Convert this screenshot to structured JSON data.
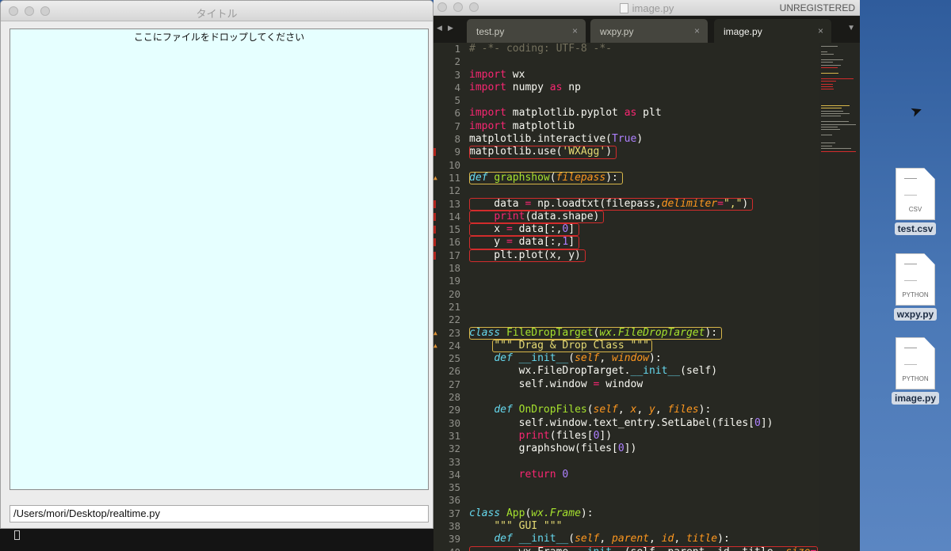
{
  "wx_window": {
    "title": "タイトル",
    "drop_label": "ここにファイルをドロップしてください",
    "path_value": "/Users/mori/Desktop/realtime.py"
  },
  "editor": {
    "title": "image.py",
    "registration": "UNREGISTERED",
    "tabs": [
      {
        "label": "test.py",
        "active": false
      },
      {
        "label": "wxpy.py",
        "active": false
      },
      {
        "label": "image.py",
        "active": true
      }
    ],
    "lines": [
      {
        "n": "1",
        "segs": [
          [
            "c",
            "# -*- coding: UTF-8 -*-"
          ]
        ]
      },
      {
        "n": "2",
        "segs": []
      },
      {
        "n": "3",
        "segs": [
          [
            "k",
            "import"
          ],
          [
            "",
            " wx"
          ]
        ]
      },
      {
        "n": "4",
        "segs": [
          [
            "k",
            "import"
          ],
          [
            "",
            " numpy "
          ],
          [
            "k",
            "as"
          ],
          [
            "",
            " np"
          ]
        ]
      },
      {
        "n": "5",
        "segs": []
      },
      {
        "n": "6",
        "segs": [
          [
            "k",
            "import"
          ],
          [
            "",
            " matplotlib.pyplot "
          ],
          [
            "k",
            "as"
          ],
          [
            "",
            " plt"
          ]
        ]
      },
      {
        "n": "7",
        "segs": [
          [
            "k",
            "import"
          ],
          [
            "",
            " matplotlib"
          ]
        ]
      },
      {
        "n": "8",
        "segs": [
          [
            "",
            "matplotlib.interactive("
          ],
          [
            "n",
            "True"
          ],
          [
            "",
            ")"
          ]
        ]
      },
      {
        "n": "9",
        "segs": [
          [
            "",
            "matplotlib.use("
          ],
          [
            "s",
            "'WXAgg'"
          ],
          [
            "",
            ")"
          ]
        ],
        "mark": "err",
        "box": "r"
      },
      {
        "n": "10",
        "segs": []
      },
      {
        "n": "11",
        "segs": [
          [
            "bi",
            "def"
          ],
          [
            "",
            " "
          ],
          [
            "f",
            "graphshow"
          ],
          [
            "",
            "("
          ],
          [
            "p",
            "filepass"
          ],
          [
            "",
            "):"
          ]
        ],
        "mark": "warn",
        "box": "y"
      },
      {
        "n": "12",
        "segs": []
      },
      {
        "n": "13",
        "segs": [
          [
            "",
            "    data "
          ],
          [
            "k",
            "="
          ],
          [
            "",
            " np.loadtxt(filepass,"
          ],
          [
            "p",
            "delimiter"
          ],
          [
            "k",
            "="
          ],
          [
            "s",
            "\",\""
          ],
          [
            "",
            ")"
          ]
        ],
        "mark": "err",
        "box": "r"
      },
      {
        "n": "14",
        "segs": [
          [
            "",
            "    "
          ],
          [
            "k",
            "print"
          ],
          [
            "",
            "(data.shape)"
          ]
        ],
        "mark": "err",
        "box": "r"
      },
      {
        "n": "15",
        "segs": [
          [
            "",
            "    x "
          ],
          [
            "k",
            "="
          ],
          [
            "",
            " data[:,"
          ],
          [
            "n",
            "0"
          ],
          [
            "",
            "]"
          ]
        ],
        "mark": "err",
        "box": "r"
      },
      {
        "n": "16",
        "segs": [
          [
            "",
            "    y "
          ],
          [
            "k",
            "="
          ],
          [
            "",
            " data[:,"
          ],
          [
            "n",
            "1"
          ],
          [
            "",
            "]"
          ]
        ],
        "mark": "err",
        "box": "r"
      },
      {
        "n": "17",
        "segs": [
          [
            "",
            "    plt.plot(x, y)"
          ]
        ],
        "mark": "err",
        "box": "r"
      },
      {
        "n": "18",
        "segs": []
      },
      {
        "n": "19",
        "segs": []
      },
      {
        "n": "20",
        "segs": []
      },
      {
        "n": "21",
        "segs": []
      },
      {
        "n": "22",
        "segs": []
      },
      {
        "n": "23",
        "segs": [
          [
            "bi",
            "class"
          ],
          [
            "",
            " "
          ],
          [
            "f",
            "FileDropTarget"
          ],
          [
            "",
            "("
          ],
          [
            "ci",
            "wx.FileDropTarget"
          ],
          [
            "",
            "):"
          ]
        ],
        "mark": "warn",
        "box": "y"
      },
      {
        "n": "24",
        "segs": [
          [
            "",
            "    "
          ],
          [
            "s",
            "\"\"\" Drag & Drop Class \"\"\""
          ]
        ],
        "mark": "warn",
        "box": "y"
      },
      {
        "n": "25",
        "segs": [
          [
            "",
            "    "
          ],
          [
            "bi",
            "def"
          ],
          [
            "",
            " "
          ],
          [
            "b",
            "__init__"
          ],
          [
            "",
            "("
          ],
          [
            "p",
            "self"
          ],
          [
            "",
            ", "
          ],
          [
            "p",
            "window"
          ],
          [
            "",
            "):"
          ]
        ]
      },
      {
        "n": "26",
        "segs": [
          [
            "",
            "        wx.FileDropTarget."
          ],
          [
            "b",
            "__init__"
          ],
          [
            "",
            "(self)"
          ]
        ]
      },
      {
        "n": "27",
        "segs": [
          [
            "",
            "        self.window "
          ],
          [
            "k",
            "="
          ],
          [
            "",
            " window"
          ]
        ]
      },
      {
        "n": "28",
        "segs": []
      },
      {
        "n": "29",
        "segs": [
          [
            "",
            "    "
          ],
          [
            "bi",
            "def"
          ],
          [
            "",
            " "
          ],
          [
            "f",
            "OnDropFiles"
          ],
          [
            "",
            "("
          ],
          [
            "p",
            "self"
          ],
          [
            "",
            ", "
          ],
          [
            "p",
            "x"
          ],
          [
            "",
            ", "
          ],
          [
            "p",
            "y"
          ],
          [
            "",
            ", "
          ],
          [
            "p",
            "files"
          ],
          [
            "",
            "):"
          ]
        ]
      },
      {
        "n": "30",
        "segs": [
          [
            "",
            "        self.window.text_entry.SetLabel(files["
          ],
          [
            "n",
            "0"
          ],
          [
            "",
            "])"
          ]
        ]
      },
      {
        "n": "31",
        "segs": [
          [
            "",
            "        "
          ],
          [
            "k",
            "print"
          ],
          [
            "",
            "(files["
          ],
          [
            "n",
            "0"
          ],
          [
            "",
            "])"
          ]
        ]
      },
      {
        "n": "32",
        "segs": [
          [
            "",
            "        graphshow(files["
          ],
          [
            "n",
            "0"
          ],
          [
            "",
            "])"
          ]
        ]
      },
      {
        "n": "33",
        "segs": []
      },
      {
        "n": "34",
        "segs": [
          [
            "",
            "        "
          ],
          [
            "k",
            "return"
          ],
          [
            "",
            " "
          ],
          [
            "n",
            "0"
          ]
        ]
      },
      {
        "n": "35",
        "segs": []
      },
      {
        "n": "36",
        "segs": []
      },
      {
        "n": "37",
        "segs": [
          [
            "bi",
            "class"
          ],
          [
            "",
            " "
          ],
          [
            "f",
            "App"
          ],
          [
            "",
            "("
          ],
          [
            "ci",
            "wx.Frame"
          ],
          [
            "",
            "):"
          ]
        ]
      },
      {
        "n": "38",
        "segs": [
          [
            "",
            "    "
          ],
          [
            "s",
            "\"\"\" GUI \"\"\""
          ]
        ]
      },
      {
        "n": "39",
        "segs": [
          [
            "",
            "    "
          ],
          [
            "bi",
            "def"
          ],
          [
            "",
            " "
          ],
          [
            "b",
            "__init__"
          ],
          [
            "",
            "("
          ],
          [
            "p",
            "self"
          ],
          [
            "",
            ", "
          ],
          [
            "p",
            "parent"
          ],
          [
            "",
            ", "
          ],
          [
            "p",
            "id"
          ],
          [
            "",
            ", "
          ],
          [
            "p",
            "title"
          ],
          [
            "",
            "):"
          ]
        ]
      },
      {
        "n": "40",
        "segs": [
          [
            "",
            "        wx.Frame."
          ],
          [
            "b",
            "__init__"
          ],
          [
            "",
            "(self, parent, id, title, "
          ],
          [
            "p",
            "size"
          ],
          [
            "k",
            "="
          ],
          [
            "",
            "("
          ]
        ],
        "box": "r"
      }
    ]
  },
  "desktop_icons": [
    {
      "name": "test.csv",
      "tag": "CSV"
    },
    {
      "name": "wxpy.py",
      "tag": "PYTHON"
    },
    {
      "name": "image.py",
      "tag": "PYTHON"
    }
  ]
}
